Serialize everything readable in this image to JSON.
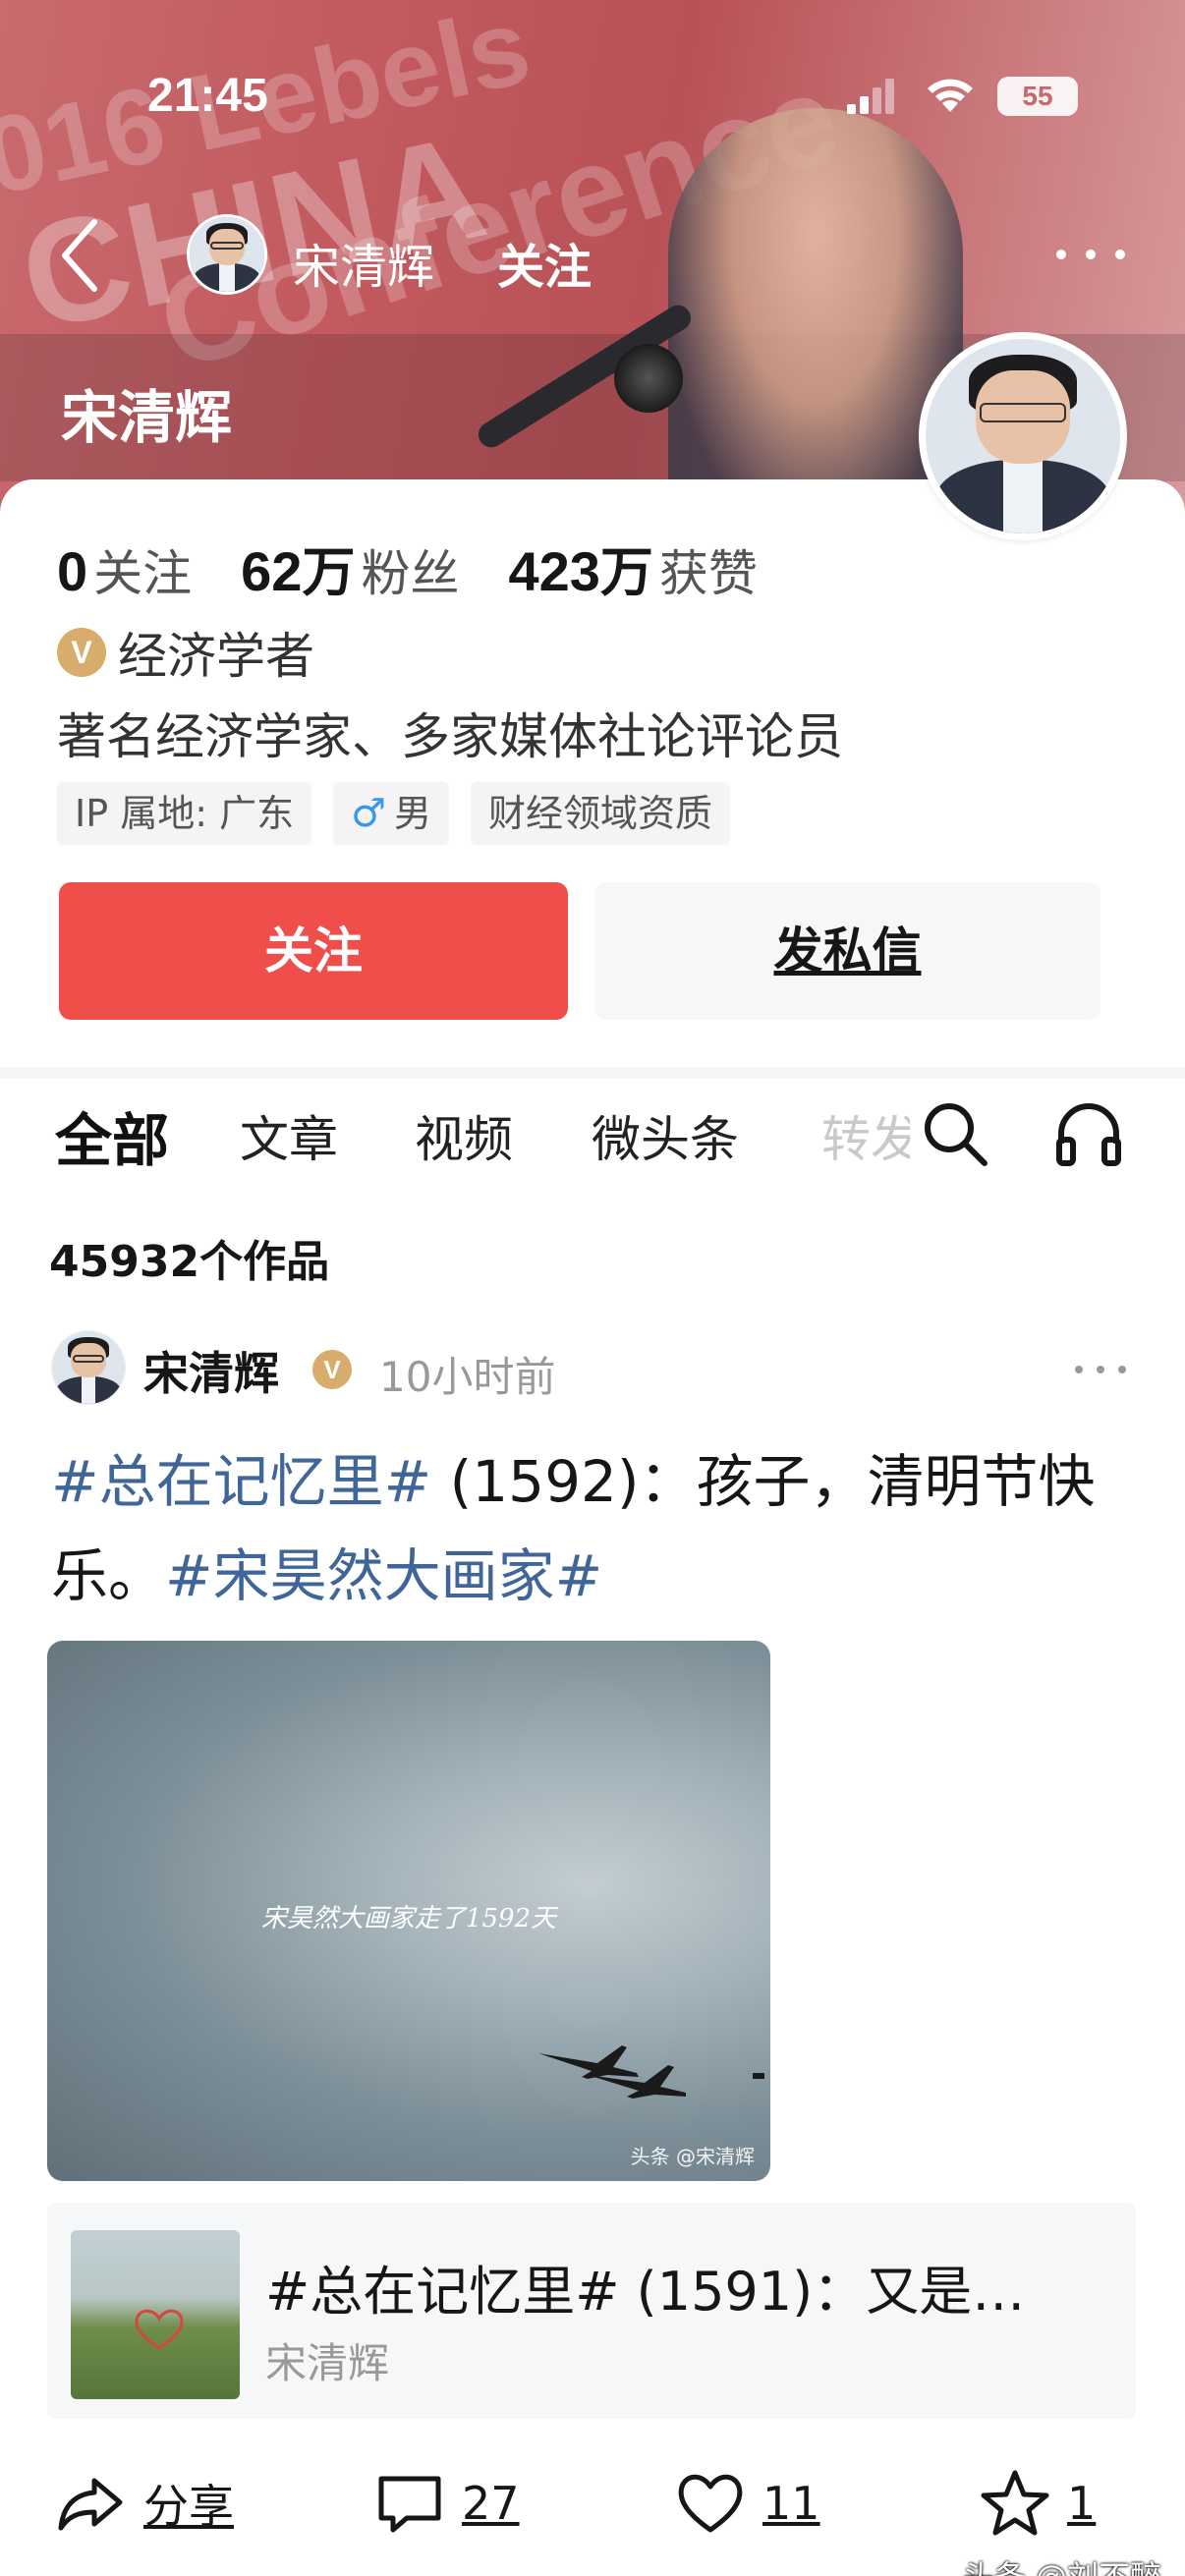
{
  "status_bar": {
    "time": "21:45",
    "battery": "55",
    "signal_icon": "cellular-signal-icon",
    "wifi_icon": "wifi-icon"
  },
  "cover": {
    "deco_lines": [
      "016 Lebels",
      "CHINA",
      "Conference"
    ]
  },
  "nav": {
    "back_icon": "chevron-left-icon",
    "name": "宋清辉",
    "follow": "关注",
    "more_icon": "more-horizontal-icon"
  },
  "profile": {
    "cover_name": "宋清辉",
    "stats": {
      "following_num": "0",
      "following_label": "关注",
      "fans_num": "62",
      "fans_unit": "万",
      "fans_label": "粉丝",
      "likes_num": "423",
      "likes_unit": "万",
      "likes_label": "获赞"
    },
    "cert_icon": "V",
    "cert": "经济学者",
    "bio": "著名经济学家、多家媒体社论评论员",
    "tags": {
      "ip": "IP 属地: 广东",
      "gender_icon": "♂",
      "gender": "男",
      "qualification": "财经领域资质"
    },
    "follow_button": "关注",
    "message_button": "发私信"
  },
  "tabs": {
    "items": [
      "全部",
      "文章",
      "视频",
      "微头条",
      "转发"
    ],
    "active": "全部",
    "search_icon": "search-icon",
    "headphone_icon": "headphone-icon"
  },
  "works_count": "45932个作品",
  "post": {
    "author": "宋清辉",
    "verified_icon": "V",
    "time": "10小时前",
    "text_hashtag1": "#总在记忆里#",
    "text_body": " (1592)：孩子，清明节快乐。",
    "text_hashtag2": "#宋昊然大画家#",
    "image_text": "宋昊然大画家走了1592天",
    "image_watermark": "头条 @宋清辉",
    "related_title": "#总在记忆里# (1591)：又是…",
    "related_author": "宋清辉"
  },
  "actions": {
    "share": "分享",
    "comments": "27",
    "likes": "11",
    "favorites": "1"
  },
  "watermark": "头条 @刘不醉",
  "colors": {
    "accent_red": "#ef4e4b",
    "hashtag_blue": "#406599",
    "verified_gold": "#d8ac6a"
  }
}
